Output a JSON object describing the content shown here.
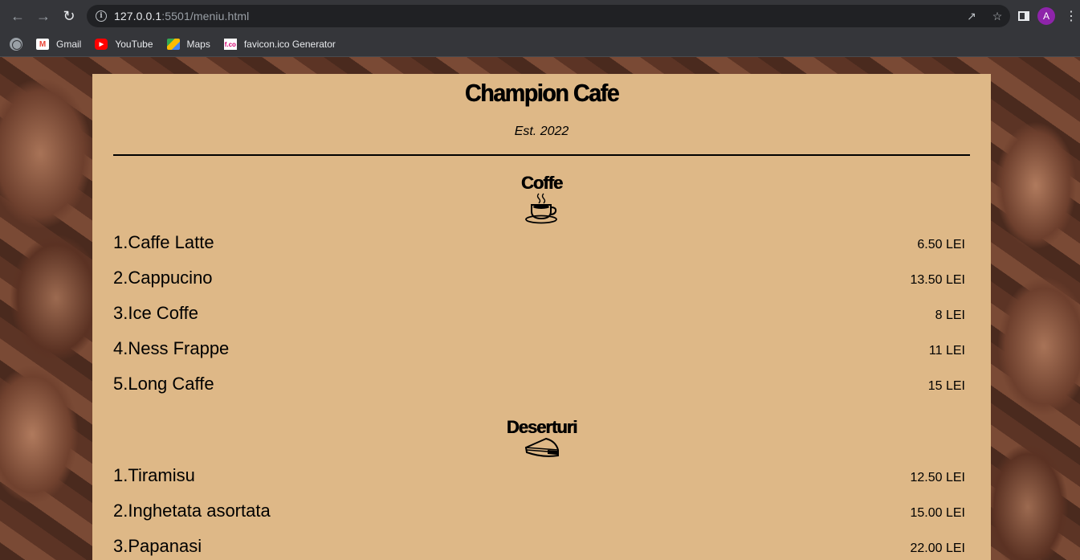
{
  "browser": {
    "url_host": "127.0.0.1",
    "url_rest": ":5501/meniu.html",
    "profile_initial": "A",
    "bookmarks": [
      {
        "label": "Gmail",
        "icon": "gmail-icon"
      },
      {
        "label": "YouTube",
        "icon": "youtube-icon"
      },
      {
        "label": "Maps",
        "icon": "maps-icon"
      },
      {
        "label": "favicon.ico Generator",
        "icon": "favicon-generator-icon"
      }
    ]
  },
  "page": {
    "title": "Champion Cafe",
    "subtitle": "Est. 2022",
    "panel_color": "#deb887",
    "sections": [
      {
        "title": "Coffe",
        "icon": "coffee-cup-icon",
        "items": [
          {
            "name": "1.Caffe Latte",
            "price": "6.50 LEI"
          },
          {
            "name": "2.Cappucino",
            "price": "13.50 LEI"
          },
          {
            "name": "3.Ice Coffe",
            "price": "8 LEI"
          },
          {
            "name": "4.Ness Frappe",
            "price": "11 LEI"
          },
          {
            "name": "5.Long Caffe",
            "price": "15 LEI"
          }
        ]
      },
      {
        "title": "Deserturi",
        "icon": "pie-slice-icon",
        "items": [
          {
            "name": "1.Tiramisu",
            "price": "12.50 LEI"
          },
          {
            "name": "2.Inghetata asortata",
            "price": "15.00 LEI"
          },
          {
            "name": "3.Papanasi",
            "price": "22.00 LEI"
          }
        ]
      }
    ]
  }
}
